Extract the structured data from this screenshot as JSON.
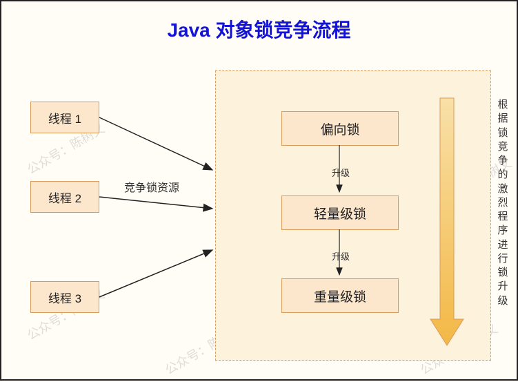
{
  "title": "Java 对象锁竞争流程",
  "threads": [
    {
      "label": "线程 1"
    },
    {
      "label": "线程 2"
    },
    {
      "label": "线程 3"
    }
  ],
  "edge_label": "竞争锁资源",
  "locks": [
    {
      "label": "偏向锁"
    },
    {
      "label": "轻量级锁"
    },
    {
      "label": "重量级锁"
    }
  ],
  "upgrade_label_1": "升级",
  "upgrade_label_2": "升级",
  "side_text": "根据锁竞争的激烈程序进行锁升级",
  "watermark": "公众号：陈树义",
  "colors": {
    "title": "#1414d8",
    "box_fill": "#fce6cc",
    "box_border": "#d89b5a",
    "container_fill": "#fdf2dc",
    "arrow_gradient_top": "#f8d78a",
    "arrow_gradient_bottom": "#f3b846"
  }
}
